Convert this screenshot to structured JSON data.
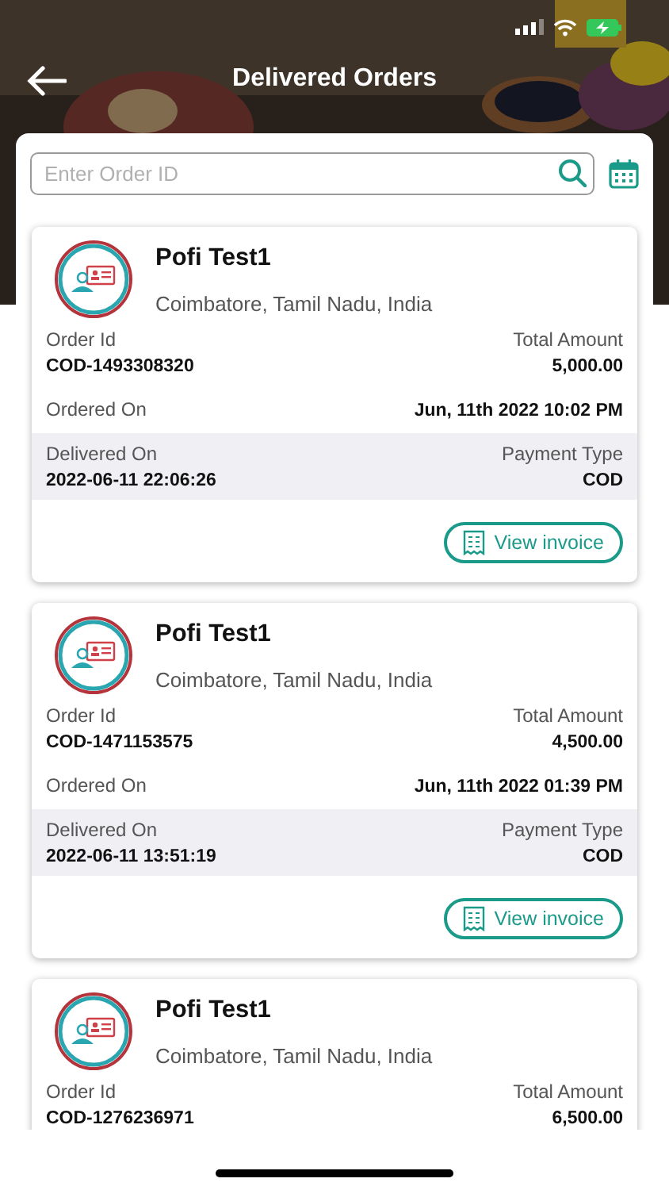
{
  "header": {
    "title": "Delivered Orders"
  },
  "search": {
    "placeholder": "Enter Order ID"
  },
  "orders": [
    {
      "name": "Pofi Test1",
      "location": "Coimbatore, Tamil Nadu, India",
      "order_id_label": "Order Id",
      "order_id": "COD-1493308320",
      "total_label": "Total Amount",
      "total": "5,000.00",
      "ordered_label": "Ordered On",
      "ordered_on": "Jun, 11th 2022 10:02 PM",
      "delivered_label": "Delivered On",
      "delivered_on": "2022-06-11 22:06:26",
      "payment_label": "Payment Type",
      "payment": "COD",
      "button": "View invoice"
    },
    {
      "name": "Pofi Test1",
      "location": "Coimbatore, Tamil Nadu, India",
      "order_id_label": "Order Id",
      "order_id": "COD-1471153575",
      "total_label": "Total Amount",
      "total": "4,500.00",
      "ordered_label": "Ordered On",
      "ordered_on": "Jun, 11th 2022 01:39 PM",
      "delivered_label": "Delivered On",
      "delivered_on": "2022-06-11 13:51:19",
      "payment_label": "Payment Type",
      "payment": "COD",
      "button": "View invoice"
    },
    {
      "name": "Pofi Test1",
      "location": "Coimbatore, Tamil Nadu, India",
      "order_id_label": "Order Id",
      "order_id": "COD-1276236971",
      "total_label": "Total Amount",
      "total": "6,500.00"
    }
  ]
}
